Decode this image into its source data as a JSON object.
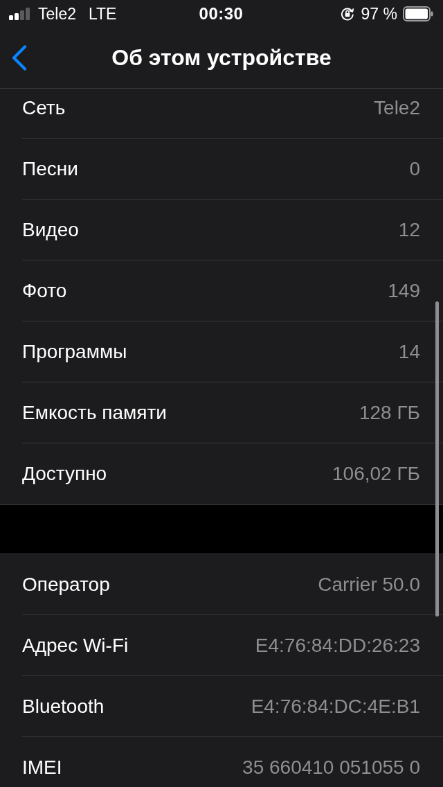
{
  "status_bar": {
    "carrier": "Tele2",
    "network": "LTE",
    "time": "00:30",
    "battery_percent": "97 %"
  },
  "nav": {
    "title": "Об этом устройстве"
  },
  "sections": [
    {
      "rows": [
        {
          "label": "Сеть",
          "value": "Tele2"
        },
        {
          "label": "Песни",
          "value": "0"
        },
        {
          "label": "Видео",
          "value": "12"
        },
        {
          "label": "Фото",
          "value": "149"
        },
        {
          "label": "Программы",
          "value": "14"
        },
        {
          "label": "Емкость памяти",
          "value": "128 ГБ"
        },
        {
          "label": "Доступно",
          "value": "106,02 ГБ"
        }
      ]
    },
    {
      "rows": [
        {
          "label": "Оператор",
          "value": "Carrier 50.0"
        },
        {
          "label": "Адрес Wi-Fi",
          "value": "E4:76:84:DD:26:23"
        },
        {
          "label": "Bluetooth",
          "value": "E4:76:84:DC:4E:B1"
        },
        {
          "label": "IMEI",
          "value": "35 660410 051055 0"
        }
      ]
    }
  ]
}
